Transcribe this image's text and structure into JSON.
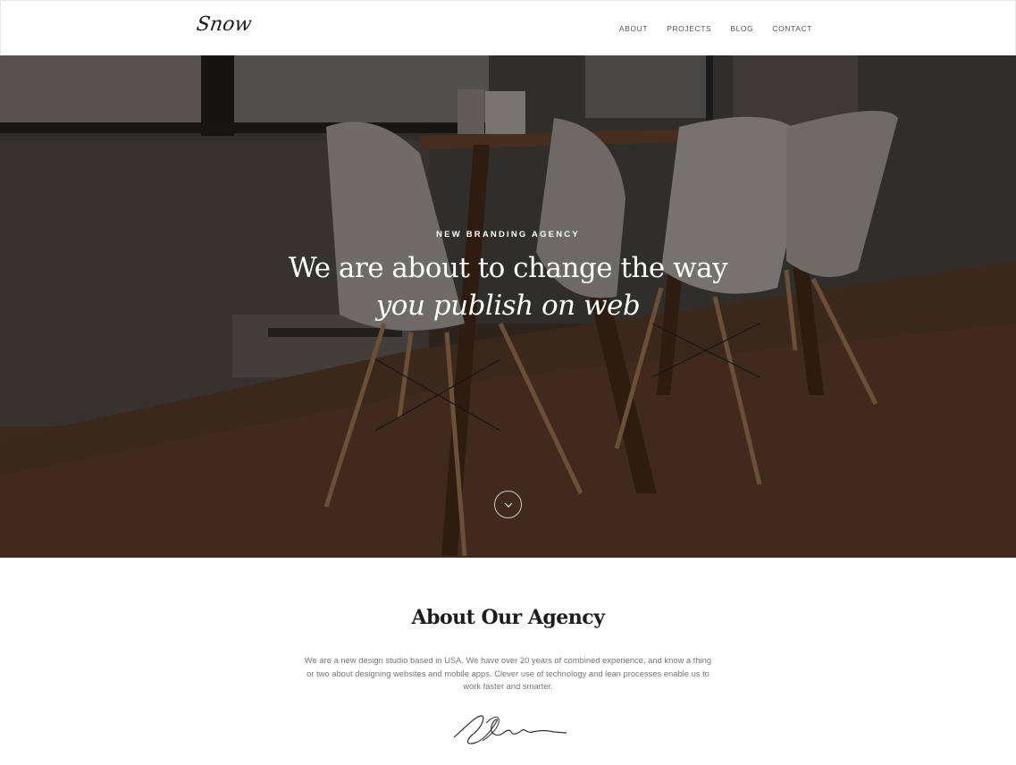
{
  "header": {
    "logo": "Snow",
    "nav": [
      "ABOUT",
      "PROJECTS",
      "BLOG",
      "CONTACT"
    ]
  },
  "hero": {
    "eyebrow": "NEW BRANDING AGENCY",
    "headline_line1": "We are about to change the way",
    "headline_line2": "you publish on web",
    "scroll_icon": "chevron-down-icon"
  },
  "about": {
    "title": "About Our Agency",
    "text": "We are a new design studio based in USA. We have over 20 years of combined experience, and know a thing or two about designing websites and mobile apps. Clever use of technology and lean processes enable us to work faster and smarter."
  }
}
